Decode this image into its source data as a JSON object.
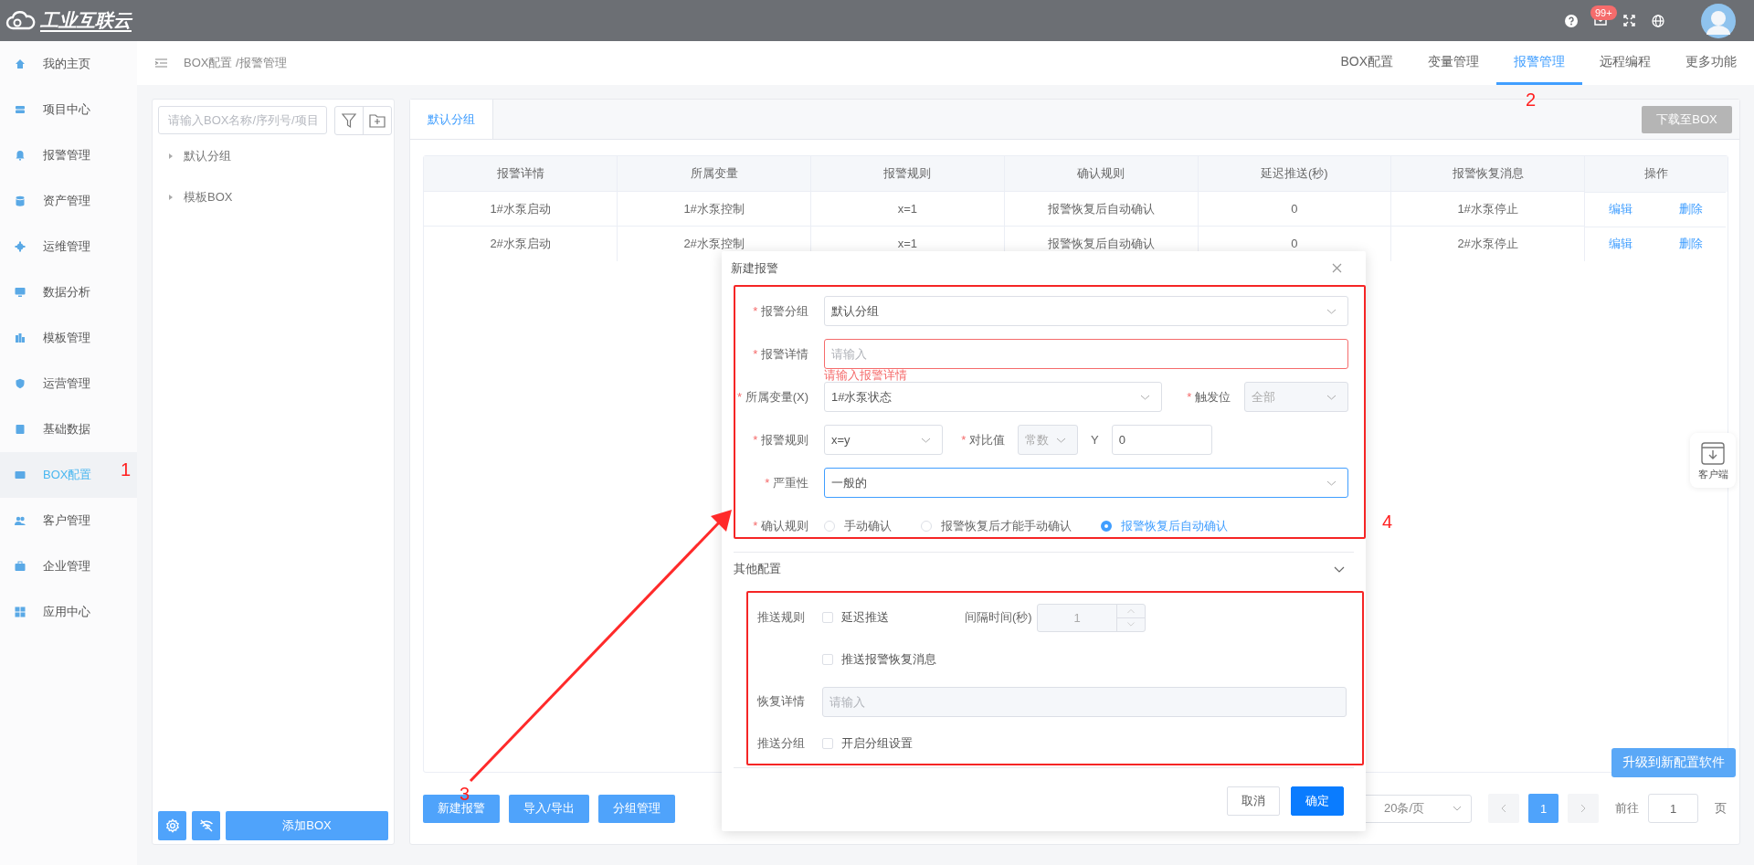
{
  "topbar": {
    "logo_text": "工业互联云",
    "mail_badge": "99+"
  },
  "sidebar": {
    "items": [
      {
        "label": "我的主页",
        "selected": false
      },
      {
        "label": "项目中心",
        "selected": false
      },
      {
        "label": "报警管理",
        "selected": false
      },
      {
        "label": "资产管理",
        "selected": false
      },
      {
        "label": "运维管理",
        "selected": false
      },
      {
        "label": "数据分析",
        "selected": false
      },
      {
        "label": "模板管理",
        "selected": false
      },
      {
        "label": "运营管理",
        "selected": false
      },
      {
        "label": "基础数据",
        "selected": false
      },
      {
        "label": "BOX配置",
        "selected": true
      },
      {
        "label": "客户管理",
        "selected": false
      },
      {
        "label": "企业管理",
        "selected": false
      },
      {
        "label": "应用中心",
        "selected": false
      }
    ]
  },
  "breadcrumb": "BOX配置 /报警管理",
  "top_tabs": [
    {
      "label": "BOX配置",
      "selected": false
    },
    {
      "label": "变量管理",
      "selected": false
    },
    {
      "label": "报警管理",
      "selected": true
    },
    {
      "label": "远程编程",
      "selected": false
    },
    {
      "label": "更多功能",
      "selected": false
    }
  ],
  "box_panel": {
    "search_placeholder": "请输入BOX名称/序列号/项目",
    "tree": [
      {
        "label": "默认分组",
        "expanded": false
      },
      {
        "label": "模板BOX",
        "expanded": false
      }
    ],
    "add_button": "添加BOX"
  },
  "group_tabs": [
    {
      "label": "默认分组",
      "selected": true
    }
  ],
  "download_button": "下载至BOX",
  "table": {
    "columns": [
      "报警详情",
      "所属变量",
      "报警规则",
      "确认规则",
      "延迟推送(秒)",
      "报警恢复消息",
      "操作"
    ],
    "rows": [
      {
        "cells": [
          "1#水泵启动",
          "1#水泵控制",
          "x=1",
          "报警恢复后自动确认",
          "0",
          "1#水泵停止"
        ],
        "actions": [
          "编辑",
          "删除"
        ]
      },
      {
        "cells": [
          "2#水泵启动",
          "2#水泵控制",
          "x=1",
          "报警恢复后自动确认",
          "0",
          "2#水泵停止"
        ],
        "actions": [
          "编辑",
          "删除"
        ]
      }
    ]
  },
  "bottom_buttons": [
    "新建报警",
    "导入/导出",
    "分组管理"
  ],
  "pagination": {
    "page_size": "20条/页",
    "pages": [
      {
        "label": "1",
        "selected": true
      }
    ],
    "goto_label": "前往",
    "goto_value": "1",
    "page_suffix": "页"
  },
  "upgrade_button": "升级到新配置软件",
  "client_widget": {
    "label": "客户端"
  },
  "dialog": {
    "title": "新建报警",
    "rows": [
      {
        "kind": "select",
        "mark": "*",
        "label": "报警分组",
        "value": "默认分组",
        "focused": false
      },
      {
        "kind": "text",
        "mark": "*",
        "label": "报警详情",
        "placeholder": "请输入",
        "error": "请输入报警详情"
      },
      {
        "kind": "variable",
        "mark": "*",
        "label": "所属变量(X)",
        "value": "1#水泵状态",
        "trigger_mark": "*",
        "trigger_label": "触发位",
        "trigger_value": "全部",
        "trigger_disabled": true
      },
      {
        "kind": "rule",
        "mark": "*",
        "label": "报警规则",
        "value": "x=y",
        "compare_mark": "*",
        "compare_label": "对比值",
        "compare_type": "常数",
        "compare_disabled": true,
        "y_label": "Y",
        "y_value": "0"
      },
      {
        "kind": "select",
        "mark": "*",
        "label": "严重性",
        "value": "一般的",
        "focused": true
      },
      {
        "kind": "radio",
        "mark": "*",
        "label": "确认规则",
        "options": [
          {
            "label": "手动确认",
            "selected": false
          },
          {
            "label": "报警恢复后才能手动确认",
            "selected": false
          },
          {
            "label": "报警恢复后自动确认",
            "selected": true
          }
        ]
      }
    ],
    "other": {
      "title": "其他配置",
      "expanded": true,
      "rows": [
        {
          "kind": "push",
          "label": "推送规则",
          "checkbox": {
            "label": "延迟推送",
            "checked": false
          },
          "interval_label": "间隔时间(秒)",
          "interval_value": "1",
          "interval_disabled": true
        },
        {
          "kind": "checkbox",
          "checkbox": {
            "label": "推送报警恢复消息",
            "checked": false
          }
        },
        {
          "kind": "text",
          "label": "恢复详情",
          "placeholder": "请输入",
          "disabled": true
        },
        {
          "kind": "checkbox",
          "label": "推送分组",
          "checkbox": {
            "label": "开启分组设置",
            "checked": false
          }
        }
      ]
    },
    "buttons": [
      {
        "label": "取消",
        "kind": "secondary"
      },
      {
        "label": "确定",
        "kind": "primary"
      }
    ]
  },
  "annotations": [
    "1",
    "2",
    "3",
    "4"
  ]
}
